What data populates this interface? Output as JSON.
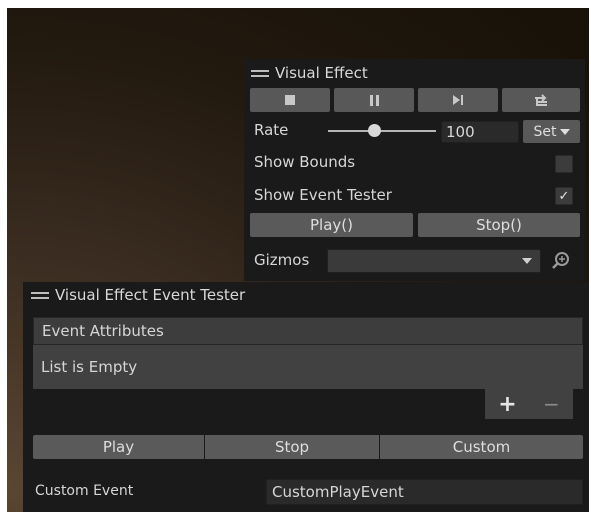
{
  "visual_effect": {
    "title": "Visual Effect",
    "rate_label": "Rate",
    "rate_value": "100",
    "rate_slider_fraction": 0.42,
    "set_label": "Set",
    "show_bounds_label": "Show Bounds",
    "show_bounds_checked": false,
    "show_event_tester_label": "Show Event Tester",
    "show_event_tester_checked": true,
    "checkmark": "✓",
    "play_label": "Play()",
    "stop_label": "Stop()",
    "gizmos_label": "Gizmos",
    "gizmos_value": ""
  },
  "event_tester": {
    "title": "Visual Effect Event Tester",
    "attributes_header": "Event Attributes",
    "list_empty": "List is Empty",
    "add_symbol": "+",
    "remove_symbol": "−",
    "play_label": "Play",
    "stop_label": "Stop",
    "custom_label": "Custom",
    "custom_event_label": "Custom Event",
    "custom_event_value": "CustomPlayEvent"
  }
}
